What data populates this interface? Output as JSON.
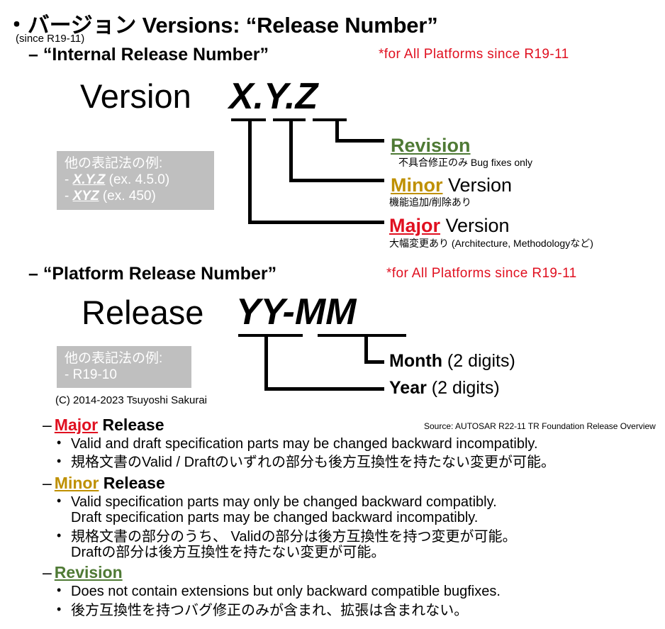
{
  "slide": {
    "title": "・バージョン Versions: “Release Number”",
    "since_note": "(since R19-11)",
    "copyright": "(C) 2014-2023 Tsuyoshi Sakurai",
    "source_note": "Source: AUTOSAR R22-11 TR Foundation Release Overview"
  },
  "section_internal": {
    "heading": "– “Internal Release Number”",
    "platform_note": "*for All Platforms since R19-11",
    "version_word": "Version",
    "version_pattern": "X.Y.Z",
    "segments": [
      "X",
      "Y",
      "Z"
    ],
    "callout": {
      "title": "他の表記法の例:",
      "line1_prefix": "- ",
      "line1_key": "X.Y.Z",
      "line1_suffix": " (ex. 4.5.0)",
      "line2_prefix": "- ",
      "line2_key": "XYZ",
      "line2_suffix": "  (ex. 450)"
    },
    "labels": [
      {
        "key": "Revision",
        "suffix": "",
        "sub": "不具合修正のみ  Bug fixes only",
        "color": "#4F7A35"
      },
      {
        "key": "Minor",
        "suffix": " Version",
        "sub": "機能追加/削除あり",
        "color": "#BF9000"
      },
      {
        "key": "Major",
        "suffix": " Version",
        "sub": "大幅変更あり (Architecture, Methodologyなど)",
        "color": "#E01020"
      }
    ]
  },
  "section_platform": {
    "heading": "– “Platform Release Number”",
    "platform_note": "*for All Platforms since R19-11",
    "release_word": "Release",
    "release_pattern": "YY-MM",
    "callout": {
      "title": "他の表記法の例:",
      "line1": "- R19-10"
    },
    "labels": [
      {
        "key": "Month",
        "suffix": " (2 digits)"
      },
      {
        "key": "Year",
        "suffix": " (2 digits)"
      }
    ]
  },
  "release_types": [
    {
      "dash": "–",
      "key": "Major",
      "suffix": " Release",
      "color": "#E01020",
      "bullets": [
        {
          "line1": "Valid and draft specification parts may be changed backward incompatibly.",
          "line2": ""
        },
        {
          "line1": "規格文書のValid / Draftのいずれの部分も後方互換性を持たない変更が可能。",
          "line2": ""
        }
      ]
    },
    {
      "dash": "–",
      "key": "Minor",
      "suffix": " Release",
      "color": "#BF9000",
      "bullets": [
        {
          "line1": "Valid  specification  parts  may  only  be  changed  backward  compatibly.",
          "line2": "Draft specification  parts may be changed backward incompatibly."
        },
        {
          "line1": "規格文書の部分のうち、 Validの部分は後方互換性を持つ変更が可能。",
          "line2": "Draftの部分は後方互換性を持たない変更が可能。"
        }
      ]
    },
    {
      "dash": "–",
      "key": "Revision",
      "suffix": "",
      "color": "#4F7A35",
      "bullets": [
        {
          "line1": "Does not contain extensions but only backward compatible bugfixes.",
          "line2": ""
        },
        {
          "line1": "後方互換性を持つバグ修正のみが含まれ、拡張は含まれない。",
          "line2": ""
        }
      ]
    }
  ],
  "colors": {
    "red": "#E01020",
    "gold": "#BF9000",
    "green": "#4F7A35",
    "gray_box": "#BFBFBF",
    "text": "#000000"
  }
}
